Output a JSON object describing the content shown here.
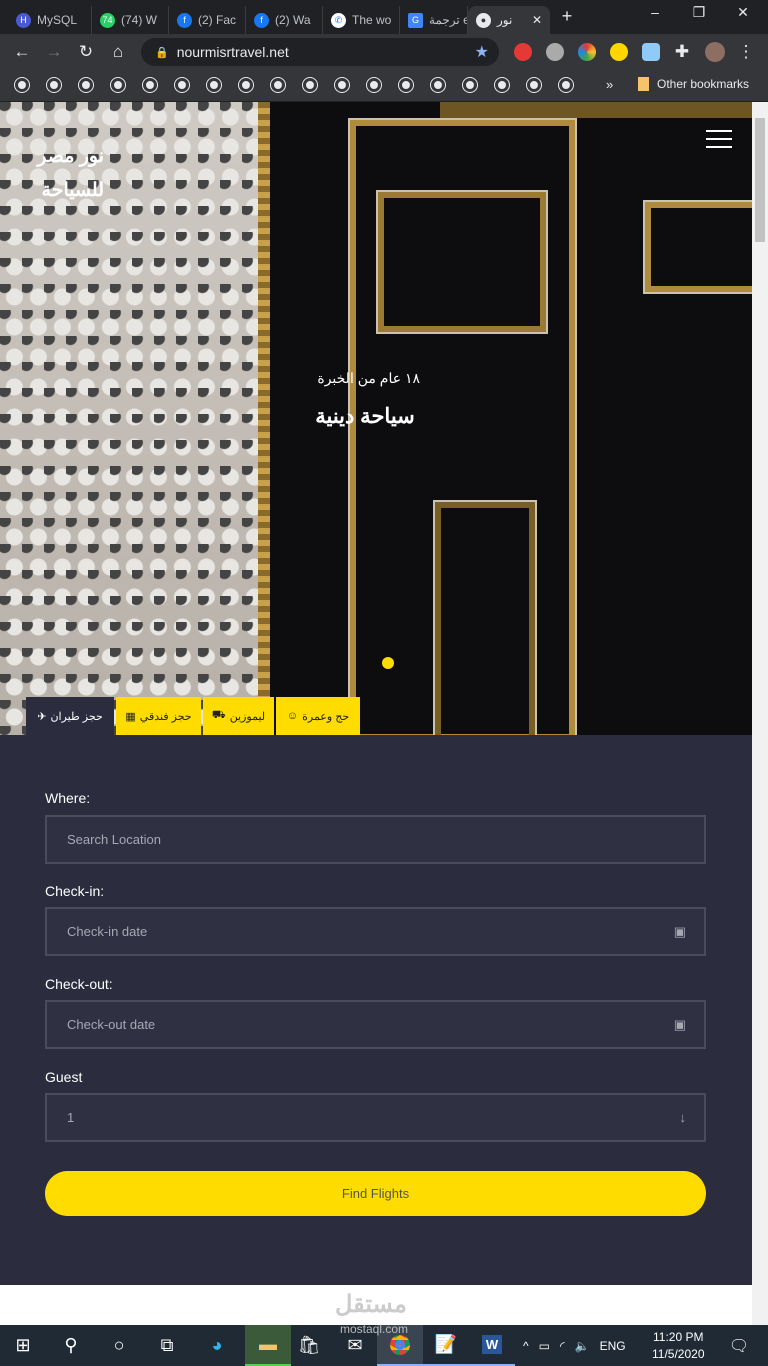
{
  "browser": {
    "tabs": [
      {
        "title": "MySQL",
        "icon": "mysql-icon",
        "color": "#4a5ad6"
      },
      {
        "title": "(74) W",
        "icon": "whatsapp-icon",
        "color": "#25d366"
      },
      {
        "title": "(2) Fac",
        "icon": "facebook-icon",
        "color": "#1877f2"
      },
      {
        "title": "(2) Wa",
        "icon": "facebook-icon",
        "color": "#1877f2"
      },
      {
        "title": "The wo",
        "icon": "phone-icon",
        "color": "#ffffff"
      },
      {
        "title": "ترجمة e",
        "icon": "translate-icon",
        "color": "#4285f4"
      },
      {
        "title": "نور",
        "icon": "globe-icon",
        "color": "#e8eaed"
      }
    ],
    "new_tab": "+",
    "url": "nourmisrtravel.net",
    "other_bookmarks": "Other bookmarks",
    "bookmark_overflow": "»"
  },
  "hero": {
    "logo_line1": "نور مصر",
    "logo_line2": "للسياحة",
    "subtitle": "١٨ عام من الخبرة",
    "title": "سياحة دينية",
    "slider_active": 1
  },
  "services": [
    {
      "label": "حجز طيران",
      "icon": "plane-icon",
      "active": true
    },
    {
      "label": "حجز فندقي",
      "icon": "hotel-icon",
      "active": false
    },
    {
      "label": "ليموزين",
      "icon": "car-icon",
      "active": false
    },
    {
      "label": "حج وعمرة",
      "icon": "pilgrim-icon",
      "active": false
    }
  ],
  "form": {
    "where_label": "Where:",
    "where_placeholder": "Search Location",
    "checkin_label": "Check-in:",
    "checkin_placeholder": "Check-in date",
    "checkout_label": "Check-out:",
    "checkout_placeholder": "Check-out date",
    "guest_label": "Guest",
    "guest_value": "1",
    "submit": "Find Flights"
  },
  "watermark": {
    "arabic": "مستقل",
    "latin": "mostaql.com"
  },
  "taskbar": {
    "time": "11:20 PM",
    "date": "11/5/2020",
    "lang": "ENG"
  },
  "colors": {
    "accent": "#ffdc00",
    "form_bg": "#2b2d3e"
  }
}
